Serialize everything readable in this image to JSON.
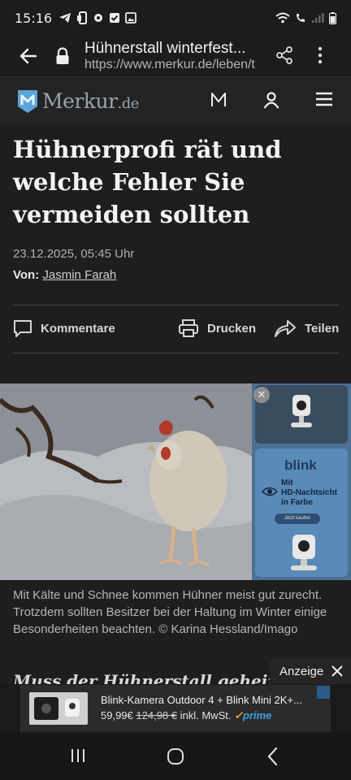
{
  "status_bar": {
    "time": "15:16",
    "left_icons": [
      "telegram-icon",
      "phone-screen-icon",
      "settings-icon",
      "checkbox-icon",
      "gallery-icon"
    ],
    "right_icons": [
      "wifi-icon",
      "wifi-call-icon",
      "signal-icon",
      "battery-icon"
    ]
  },
  "browser": {
    "page_title": "Hühnerstall winterfest...",
    "url": "https://www.merkur.de/leben/t"
  },
  "site": {
    "logo_text": "Merkur",
    "logo_suffix": ".de"
  },
  "article": {
    "headline": "Hühnerprofi rät und welche Fehler Sie vermeiden sollten",
    "date": "23.12.2025, 05:45 Uhr",
    "author_label": "Von:",
    "author_name": "Jasmin Farah",
    "actions": {
      "comments": "Kommentare",
      "print": "Drucken",
      "share": "Teilen"
    },
    "caption": "Mit Kälte und Schnee kommen Hühner meist gut zurecht. Trotzdem sollten Besitzer bei der Haltung im Winter einige Besonderheiten beachten. © Karina Hessland/Imago",
    "subheading": "Muss der Hühnerstall geheizt wer"
  },
  "side_ad": {
    "brand": "blink",
    "lines": [
      "Mit",
      "HD-Nachtsicht",
      "in Farbe"
    ],
    "cta": "Jetzt kaufen"
  },
  "bottom_ad": {
    "label": "Anzeige",
    "title": "Blink-Kamera Outdoor 4 + Blink Mini 2K+...",
    "price": "59,99€",
    "old_price": "124,98 €",
    "tax": "inkl. MwSt.",
    "prime": "prime"
  }
}
